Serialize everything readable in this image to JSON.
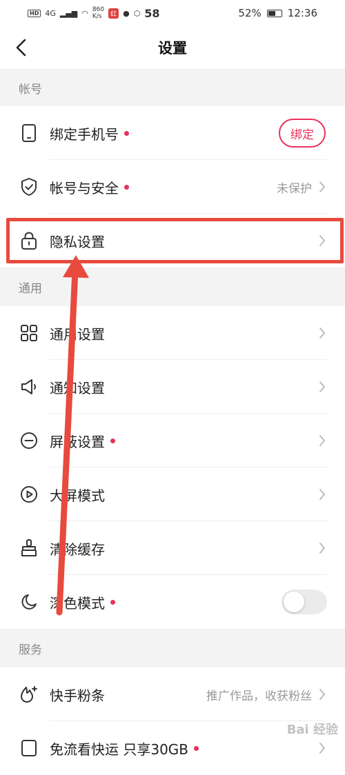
{
  "status_bar": {
    "hd": "HD",
    "net": "4G",
    "speed_top": "860",
    "speed_bottom": "K/s",
    "app_badge": "红",
    "count": "58",
    "battery": "52%",
    "time": "12:36"
  },
  "header": {
    "title": "设置"
  },
  "sections": {
    "account": "帐号",
    "general": "通用",
    "service": "服务"
  },
  "rows": {
    "bind_phone": {
      "label": "绑定手机号",
      "button": "绑定"
    },
    "account_security": {
      "label": "帐号与安全",
      "value": "未保护"
    },
    "privacy": {
      "label": "隐私设置"
    },
    "general_settings": {
      "label": "通用设置"
    },
    "notification": {
      "label": "通知设置"
    },
    "block": {
      "label": "屏蔽设置"
    },
    "big_screen": {
      "label": "大屏模式"
    },
    "clear_cache": {
      "label": "清除缓存"
    },
    "dark_mode": {
      "label": "深色模式",
      "toggle_on": false
    },
    "fans": {
      "label": "快手粉条",
      "value": "推广作品，收获粉丝"
    },
    "free_flow": {
      "label": "免流看快运 只享30GB"
    }
  },
  "watermark": "Bai 经验",
  "colors": {
    "accent": "#e8315c",
    "annotation": "#e84a3e"
  }
}
